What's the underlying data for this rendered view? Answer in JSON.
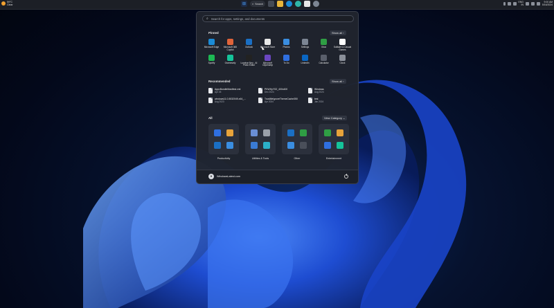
{
  "taskbar": {
    "weather": {
      "temp": "59°C",
      "condition": "Clear"
    },
    "search_label": "Search",
    "tray": {
      "language": "ENG",
      "language_sub": "IN",
      "time": "9:00 AM",
      "date": "5/16/2024"
    }
  },
  "start_menu": {
    "search_placeholder": "Search for apps, settings, and documents",
    "pinned": {
      "title": "Pinned",
      "all_button": "Show all  ›",
      "apps": [
        {
          "label": "Microsoft Edge",
          "icon": "edge-icon",
          "color": "#1b8bd6"
        },
        {
          "label": "Microsoft 365 Copilot",
          "icon": "office-icon",
          "color": "#e0643a"
        },
        {
          "label": "Outlook",
          "icon": "outlook-icon",
          "color": "#1a6fc4"
        },
        {
          "label": "Microsoft Store",
          "icon": "store-icon",
          "color": "#e8e8e8"
        },
        {
          "label": "Photos",
          "icon": "photos-icon",
          "color": "#3a8de0"
        },
        {
          "label": "Settings",
          "icon": "gear-icon",
          "color": "#7c8593"
        },
        {
          "label": "Xbox",
          "icon": "xbox-icon",
          "color": "#2f9e44"
        },
        {
          "label": "Solitaire & Casual Games",
          "icon": "cards-icon",
          "color": "#ffffff"
        },
        {
          "label": "Spotify",
          "icon": "spotify-icon",
          "color": "#1db954"
        },
        {
          "label": "Grammarly",
          "icon": "grammarly-icon",
          "color": "#15c39a"
        },
        {
          "label": "Luminar Neo - AI Photo Editor",
          "icon": "luminar-icon",
          "color": "#222222"
        },
        {
          "label": "Microsoft Clipchamp",
          "icon": "clipchamp-icon",
          "color": "#6b46c1"
        },
        {
          "label": "To Do",
          "icon": "todo-icon",
          "color": "#2f6fe0"
        },
        {
          "label": "LinkedIn",
          "icon": "linkedin-icon",
          "color": "#0a66c2"
        },
        {
          "label": "Calculator",
          "icon": "calculator-icon",
          "color": "#5a5f6b"
        },
        {
          "label": "Clock",
          "icon": "clock-icon",
          "color": "#8a8f99"
        }
      ]
    },
    "recommended": {
      "title": "Recommended",
      "all_button": "Show all  ›",
      "items": [
        {
          "name": "AppxBundleManifest.xml",
          "date": "Apr 26"
        },
        {
          "name": "PKWHyYS2_400x400",
          "date": "Dec 2024"
        },
        {
          "name": "Windows",
          "date": "Aug 2024"
        },
        {
          "name": "windows11.0-5032049-x64_...",
          "date": "Aug 2023"
        },
        {
          "name": "TrustMeIgnoreThemeCache350",
          "date": "Apr 2024"
        },
        {
          "name": "test",
          "date": "Jan 2024"
        }
      ]
    },
    "all": {
      "title": "All",
      "view_button": "View Category  ⌄",
      "categories": [
        {
          "label": "Productivity",
          "colors": [
            "#2f6fe0",
            "#e8a33a",
            "#1a6fc4",
            "#3a8de0"
          ]
        },
        {
          "label": "Utilities & Tools",
          "colors": [
            "#6a8fd6",
            "#9aa0aa",
            "#3a7bd5",
            "#2bb0c9"
          ]
        },
        {
          "label": "Other",
          "colors": [
            "#1a6fc4",
            "#2f9e44",
            "#3a8de0",
            "#4a4f5a"
          ]
        },
        {
          "label": "Entertainment",
          "colors": [
            "#2f9e44",
            "#e8a33a",
            "#2f6fe0",
            "#15c39a"
          ]
        }
      ],
      "partial_row": [
        [
          "#3a8de0",
          "#9aa0aa"
        ],
        [
          "#6b46c1",
          "#8a8f99"
        ],
        [
          "#e0643a",
          "#d9dce2"
        ],
        [
          "#2f6fe0",
          "#1db954"
        ]
      ]
    },
    "footer": {
      "user_name": "WindowsLatest.com"
    }
  }
}
